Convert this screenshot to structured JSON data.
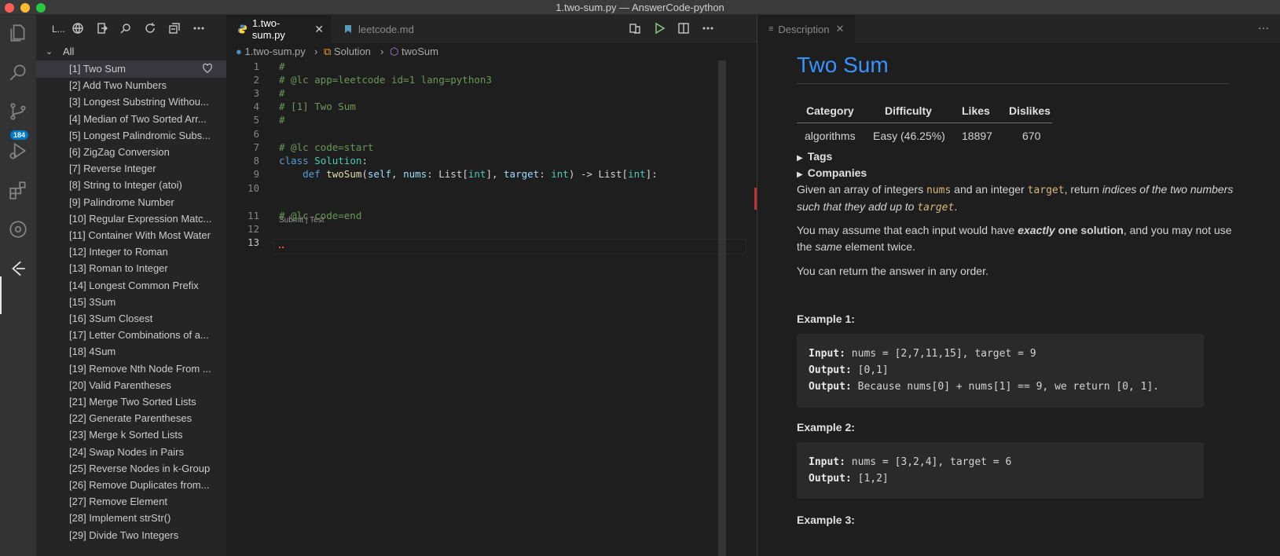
{
  "window": {
    "title": "1.two-sum.py — AnswerCode-python"
  },
  "activity_bar": {
    "badge": "184"
  },
  "sidebar": {
    "header": "L...",
    "root": "All",
    "items": [
      "[1] Two Sum",
      "[2] Add Two Numbers",
      "[3] Longest Substring Withou...",
      "[4] Median of Two Sorted Arr...",
      "[5] Longest Palindromic Subs...",
      "[6] ZigZag Conversion",
      "[7] Reverse Integer",
      "[8] String to Integer (atoi)",
      "[9] Palindrome Number",
      "[10] Regular Expression Matc...",
      "[11] Container With Most Water",
      "[12] Integer to Roman",
      "[13] Roman to Integer",
      "[14] Longest Common Prefix",
      "[15] 3Sum",
      "[16] 3Sum Closest",
      "[17] Letter Combinations of a...",
      "[18] 4Sum",
      "[19] Remove Nth Node From ...",
      "[20] Valid Parentheses",
      "[21] Merge Two Sorted Lists",
      "[22] Generate Parentheses",
      "[23] Merge k Sorted Lists",
      "[24] Swap Nodes in Pairs",
      "[25] Reverse Nodes in k-Group",
      "[26] Remove Duplicates from...",
      "[27] Remove Element",
      "[28] Implement strStr()",
      "[29] Divide Two Integers"
    ]
  },
  "editor": {
    "tabs": [
      {
        "label": "1.two-sum.py"
      },
      {
        "label": "leetcode.md"
      }
    ],
    "breadcrumb": [
      "1.two-sum.py",
      "Solution",
      "twoSum"
    ],
    "line_numbers": [
      "1",
      "2",
      "3",
      "4",
      "5",
      "6",
      "7",
      "8",
      "9",
      "10",
      "11",
      "12",
      "13"
    ],
    "lines": {
      "l1": "#",
      "l2": "# @lc app=leetcode id=1 lang=python3",
      "l3": "#",
      "l4": "# [1] Two Sum",
      "l5": "#",
      "l7": "# @lc code=start",
      "l8_kw": "class",
      "l8_cls": "Solution",
      "l8_tx": ":",
      "l9_kw": "def",
      "l9_fn": "twoSum",
      "l9_a": "(",
      "l9_self": "self",
      "l9_b": ", ",
      "l9_nums": "nums",
      "l9_c": ": List[",
      "l9_int1": "int",
      "l9_d": "], ",
      "l9_target": "target",
      "l9_e": ": ",
      "l9_int2": "int",
      "l9_f": ") -> List[",
      "l9_int3": "int",
      "l9_g": "]:",
      "l11": "# @lc code=end"
    },
    "codelens": "Submit | Test"
  },
  "preview": {
    "tab_label": "Description",
    "title": "Two Sum",
    "table": {
      "headers": [
        "Category",
        "Difficulty",
        "Likes",
        "Dislikes"
      ],
      "row": [
        "algorithms",
        "Easy (46.25%)",
        "18897",
        "670"
      ]
    },
    "tags_label": "Tags",
    "companies_label": "Companies",
    "p1": {
      "a": "Given an array of integers ",
      "nums": "nums",
      "b": " and an integer ",
      "target": "target",
      "c": ", return ",
      "em": "indices of the two numbers such that they add up to ",
      "target2": "target",
      "d": "."
    },
    "p2": {
      "a": "You may assume that each input would have ",
      "em": "exactly",
      "b": " one solution",
      "c": ", and you may not use the ",
      "same": "same",
      "d": " element twice."
    },
    "p3": "You can return the answer in any order.",
    "ex1_title": "Example 1:",
    "ex1": {
      "in_lbl": "Input:",
      "in_val": " nums = [2,7,11,15], target = 9",
      "out_lbl": "Output:",
      "out_val": " [0,1]",
      "out2_lbl": "Output:",
      "out2_val": " Because nums[0] + nums[1] == 9, we return [0, 1]."
    },
    "ex2_title": "Example 2:",
    "ex2": {
      "in_lbl": "Input:",
      "in_val": " nums = [3,2,4], target = 6",
      "out_lbl": "Output:",
      "out_val": " [1,2]"
    },
    "ex3_title": "Example 3:"
  }
}
